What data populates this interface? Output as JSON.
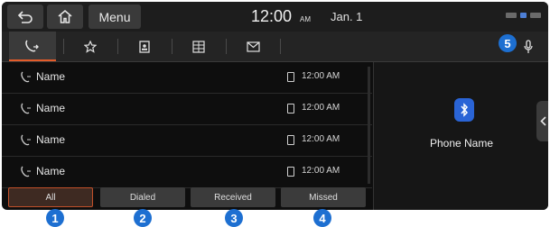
{
  "topbar": {
    "menu_label": "Menu",
    "time": "12:00",
    "ampm": "AM",
    "date": "Jan. 1",
    "icons": [
      "back-icon",
      "home-icon",
      "battery-icon",
      "signal-icon"
    ]
  },
  "tabs": [
    {
      "icon": "call-history-icon",
      "active": true
    },
    {
      "icon": "favorites-icon",
      "active": false
    },
    {
      "icon": "contacts-icon",
      "active": false
    },
    {
      "icon": "dial-pad-icon",
      "active": false
    },
    {
      "icon": "message-icon",
      "active": false
    }
  ],
  "call_list": [
    {
      "name": "Name",
      "time": "12:00 AM"
    },
    {
      "name": "Name",
      "time": "12:00 AM"
    },
    {
      "name": "Name",
      "time": "12:00 AM"
    },
    {
      "name": "Name",
      "time": "12:00 AM"
    }
  ],
  "filters": {
    "all": "All",
    "dialed": "Dialed",
    "received": "Received",
    "missed": "Missed",
    "active": "All"
  },
  "device_panel": {
    "phone_name": "Phone Name",
    "icon": "bluetooth-icon"
  },
  "callouts": {
    "c1": "1",
    "c2": "2",
    "c3": "3",
    "c4": "4",
    "c5": "5"
  },
  "colors": {
    "accent": "#e35c2a",
    "callout": "#1d6fd1",
    "bluetooth": "#2a64d6"
  }
}
